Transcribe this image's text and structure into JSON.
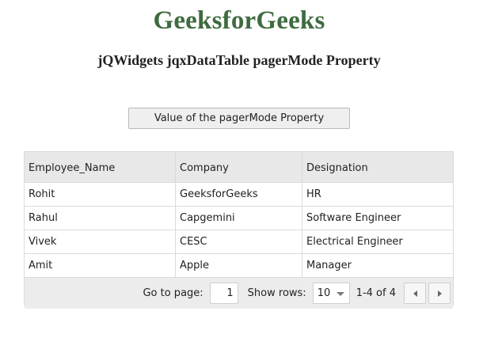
{
  "header": {
    "title": "GeeksforGeeks",
    "subtitle": "jQWidgets jqxDataTable pagerMode Property",
    "title_color": "#3e6b3f"
  },
  "action": {
    "button_label": "Value of the pagerMode Property"
  },
  "table": {
    "columns": [
      "Employee_Name",
      "Company",
      "Designation"
    ],
    "rows": [
      [
        "Rohit",
        "GeeksforGeeks",
        "HR"
      ],
      [
        "Rahul",
        "Capgemini",
        "Software Engineer"
      ],
      [
        "Vivek",
        "CESC",
        "Electrical Engineer"
      ],
      [
        "Amit",
        "Apple",
        "Manager"
      ]
    ]
  },
  "pager": {
    "goto_label": "Go to page:",
    "page_value": "1",
    "show_rows_label": "Show rows:",
    "rows_value": "10",
    "range_text": "1-4 of 4",
    "prev_icon": "chevron-left-icon",
    "next_icon": "chevron-right-icon",
    "select_icon": "chevron-down-icon"
  }
}
